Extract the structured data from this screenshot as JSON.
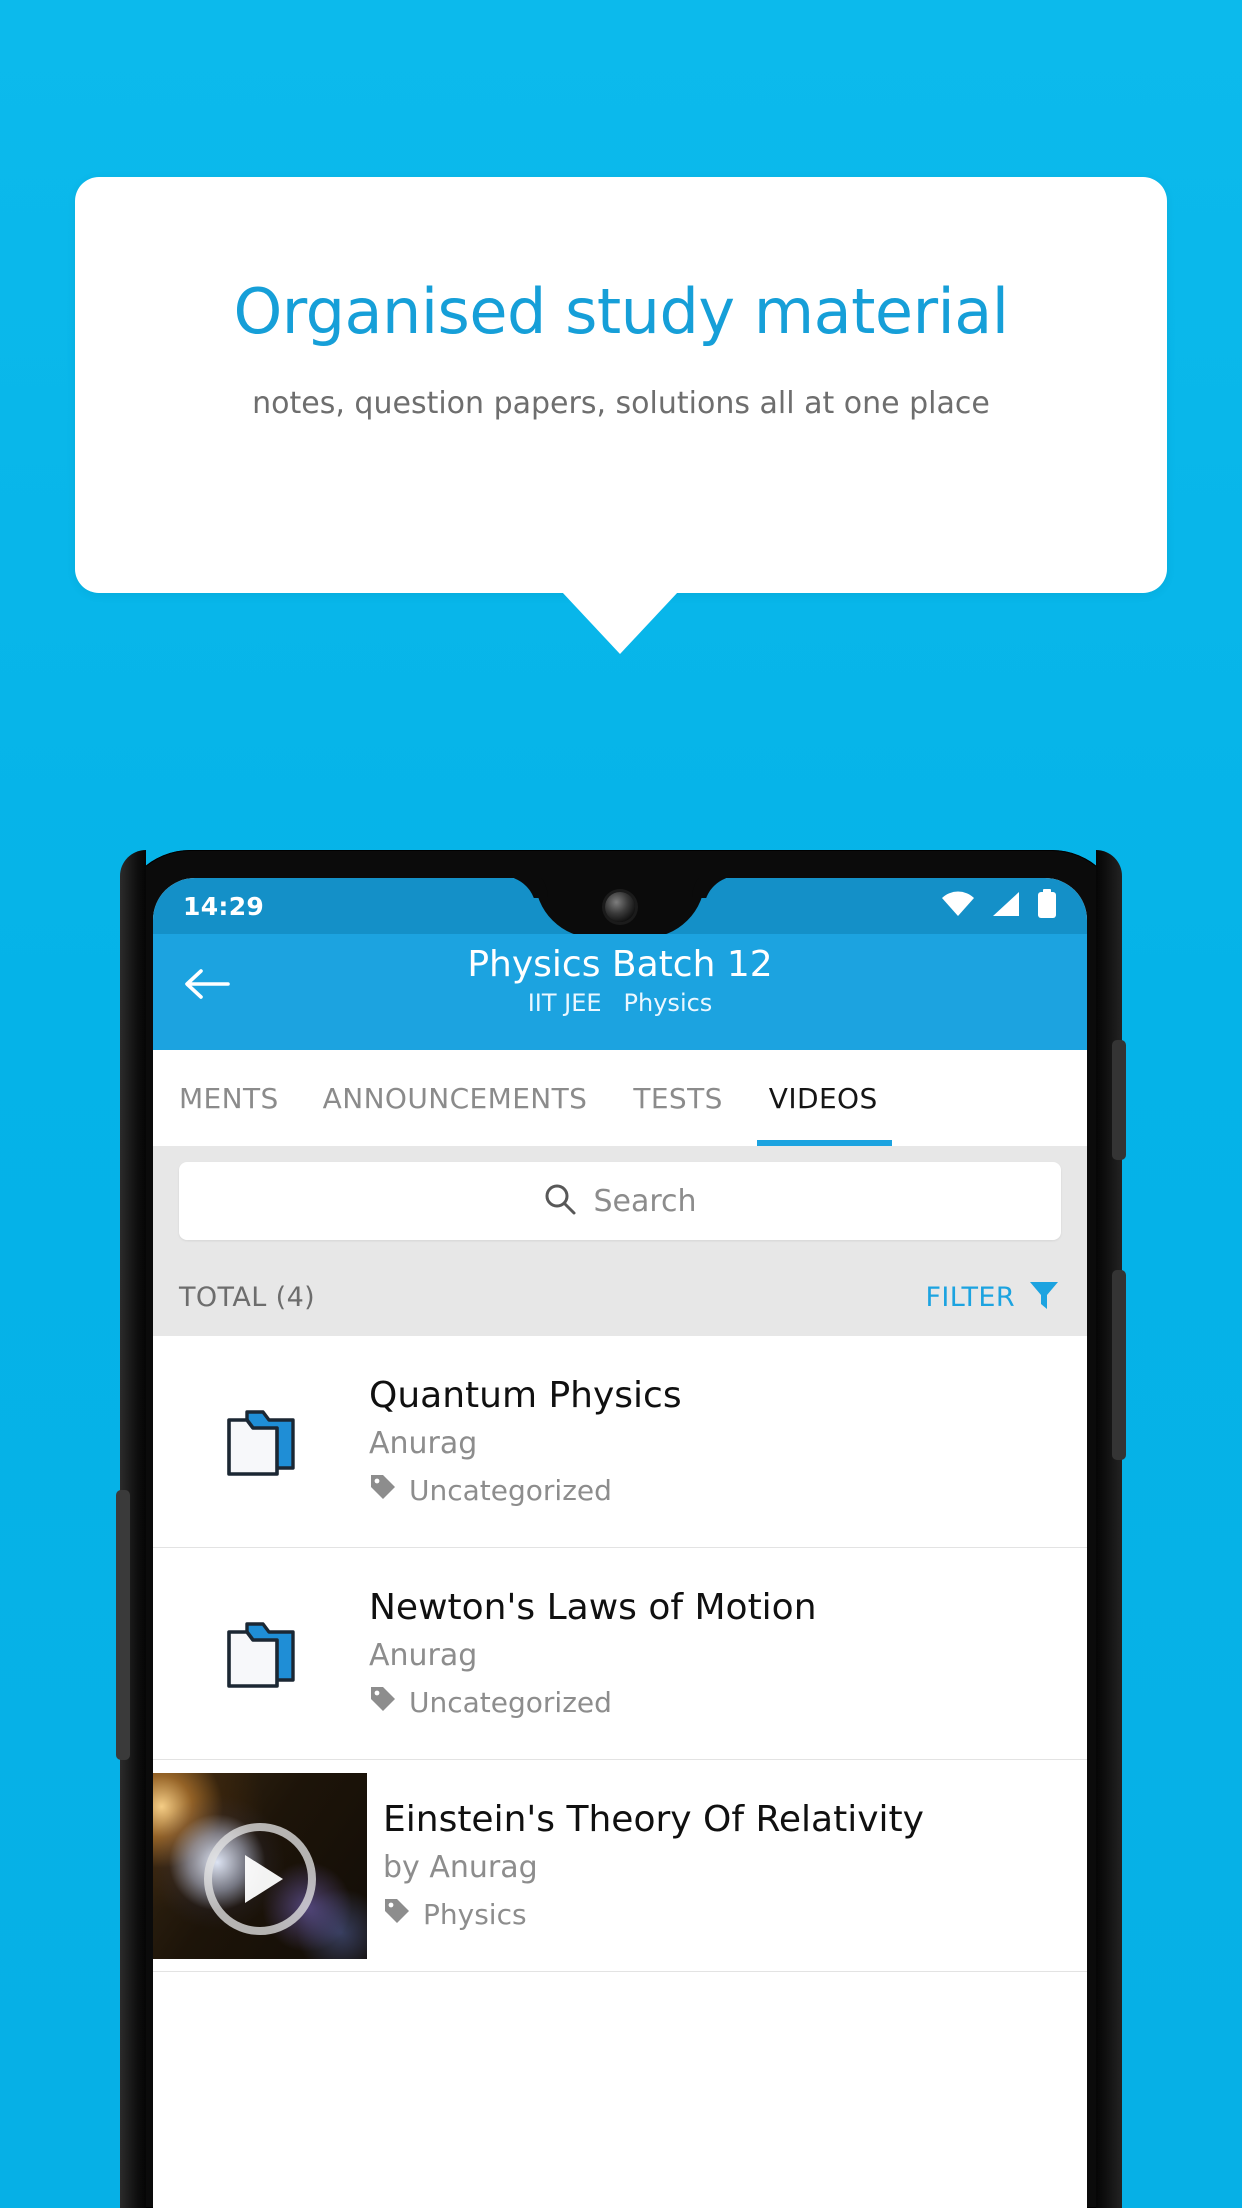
{
  "promo": {
    "title": "Organised study material",
    "subtitle": "notes, question papers, solutions all at one place",
    "title_color": "#169fd8",
    "subtitle_color": "#6e6e6e",
    "background_color": "#06b2e8",
    "card_color": "#ffffff"
  },
  "phone": {
    "status_bar": {
      "time": "14:29",
      "icons": [
        "wifi-icon",
        "signal-icon",
        "battery-icon"
      ],
      "background_color": "#1490c8"
    },
    "app_bar": {
      "back_label": "back-arrow-icon",
      "title": "Physics Batch 12",
      "subtitle_exam": "IIT JEE",
      "subtitle_subject": "Physics",
      "background_color": "#1ca3e0"
    },
    "tabs": [
      {
        "label": "MENTS",
        "active": false
      },
      {
        "label": "ANNOUNCEMENTS",
        "active": false
      },
      {
        "label": "TESTS",
        "active": false
      },
      {
        "label": "VIDEOS",
        "active": true
      }
    ],
    "search": {
      "placeholder": "Search",
      "value": "",
      "icon": "search-icon"
    },
    "toolbar": {
      "total_label": "TOTAL (4)",
      "filter_label": "FILTER",
      "filter_icon": "filter-funnel-icon",
      "filter_color": "#1ca3e0"
    },
    "list": [
      {
        "type": "folder",
        "icon": "folder-icon",
        "title": "Quantum Physics",
        "author": "Anurag",
        "tag": "Uncategorized",
        "tag_icon": "tag-icon"
      },
      {
        "type": "folder",
        "icon": "folder-icon",
        "title": "Newton's Laws of Motion",
        "author": "Anurag",
        "tag": "Uncategorized",
        "tag_icon": "tag-icon"
      },
      {
        "type": "video",
        "icon": "video-thumbnail",
        "title": "Einstein's Theory Of Relativity",
        "author": "by Anurag",
        "tag": "Physics",
        "tag_icon": "tag-icon",
        "play_icon": "play-icon"
      }
    ]
  }
}
